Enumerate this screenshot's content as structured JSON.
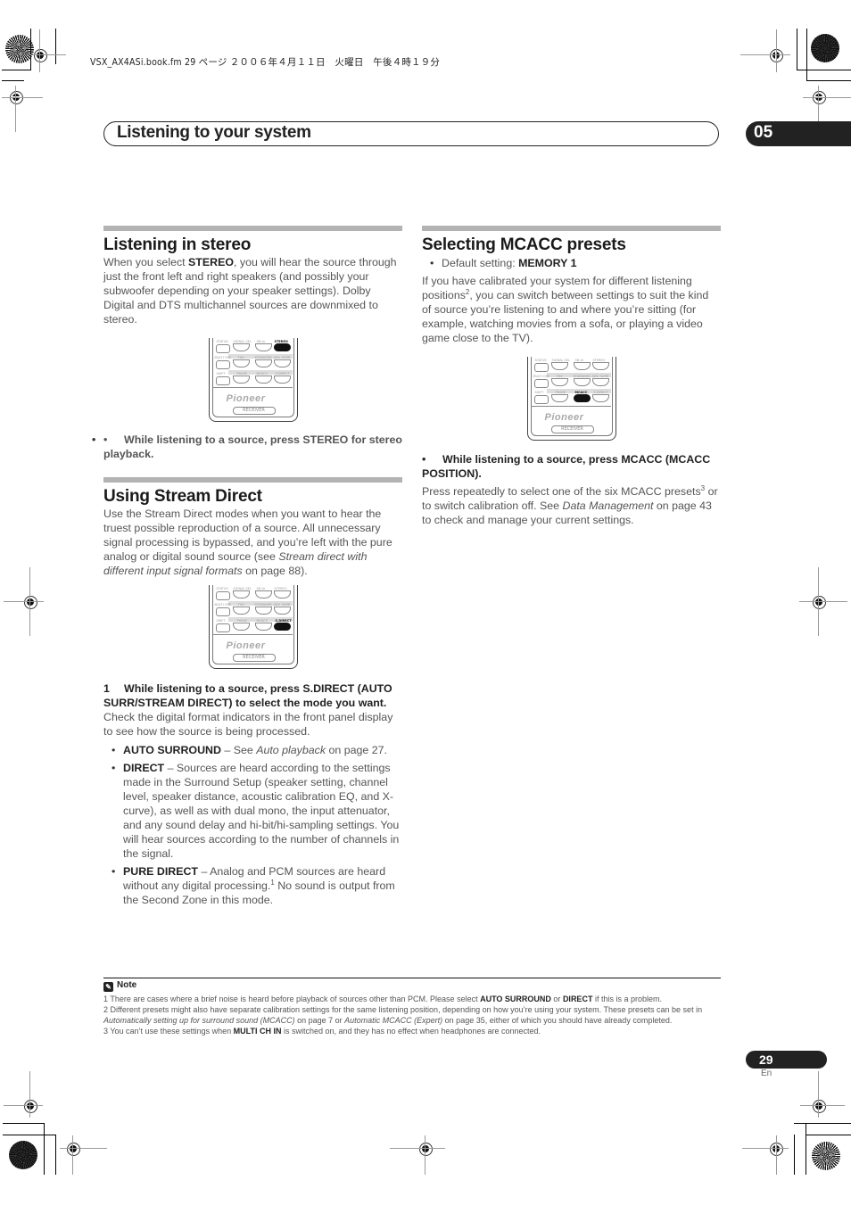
{
  "file_header": "VSX_AX4ASi.book.fm  29 ページ  ２００６年４月１１日　火曜日　午後４時１９分",
  "chapter": {
    "title": "Listening to your system",
    "number": "05"
  },
  "sections": {
    "stereo": {
      "heading": "Listening in stereo",
      "body_pre": "When you select ",
      "body_bold": "STEREO",
      "body_post": ", you will hear the source through just the front left and right speakers (and possibly your subwoofer depending on your speaker settings). Dolby Digital and DTS multichannel sources are downmixed to stereo.",
      "instruction": "While listening to a source, press STEREO for stereo playback.",
      "highlighted_key": "STEREO"
    },
    "stream_direct": {
      "heading": "Using Stream Direct",
      "body_pre": "Use the Stream Direct modes when you want to hear the truest possible reproduction of a source. All unnecessary signal processing is bypassed, and you’re left with the pure analog or digital sound source (see ",
      "body_italic": "Stream direct with different input signal formats",
      "body_post": " on page 88).",
      "step_number": "1",
      "step_text": "While listening to a source, press S.DIRECT (AUTO SURR/STREAM DIRECT) to select the mode you want.",
      "step_detail": "Check the digital format indicators in the front panel display to see how the source is being processed.",
      "highlighted_key": "S.DIRECT",
      "modes": [
        {
          "name": "AUTO SURROUND",
          "sep": " – See ",
          "italic": "Auto playback",
          "text": " on page 27."
        },
        {
          "name": "DIRECT",
          "sep": " – ",
          "italic": "",
          "text": "Sources are heard according to the settings made in the Surround Setup (speaker setting, channel level, speaker distance, acoustic calibration EQ, and X-curve), as well as with dual mono, the input attenuator, and any sound delay and hi-bit/hi-sampling settings. You will hear sources according to the number of channels in the signal."
        },
        {
          "name": "PURE DIRECT",
          "sep": " – ",
          "italic": "",
          "text": "Analog and PCM sources are heard without any digital processing.",
          "sup": "1",
          "text2": " No sound is output from the Second Zone in this mode."
        }
      ]
    },
    "mcacc": {
      "heading": "Selecting MCACC presets",
      "default_label": "Default setting: ",
      "default_value": "MEMORY 1",
      "body_pre": "If you have calibrated your system for different listening positions",
      "body_sup": "2",
      "body_post": ", you can switch between settings to suit the kind of source you’re listening to and where you’re sitting (for example, watching movies from a sofa, or playing a video game close to the TV).",
      "instruction": "While listening to a source, press MCACC (MCACC POSITION).",
      "detail_pre": "Press repeatedly to select one of the six MCACC presets",
      "detail_sup": "3",
      "detail_mid": " or to switch calibration off. See ",
      "detail_italic": "Data Management",
      "detail_post": " on page 43 to check and manage your current settings.",
      "highlighted_key": "MCACC"
    }
  },
  "remote": {
    "keys_row1": [
      "STATUS",
      "SIGNAL SEL",
      "SB ch",
      "STEREO"
    ],
    "keys_row2": [
      "MULTI OPE",
      "THX",
      "STANDARD",
      "ADV. SURR"
    ],
    "keys_row3": [
      "SHIFT",
      "PHASE",
      "MCACC",
      "S.DIRECT"
    ],
    "brand": "Pioneer",
    "mode_label": "RECEIVER"
  },
  "notes": {
    "heading": "Note",
    "items": [
      {
        "n": "1",
        "pre": "There are cases where a brief noise is heard before playback of sources other than PCM. Please select ",
        "b1": "AUTO SURROUND",
        "mid": " or ",
        "b2": "DIRECT",
        "post": " if this is a problem."
      },
      {
        "n": "2",
        "pre": "Different presets might also have separate calibration settings for the same listening position, depending on how you’re using your system. These presets can be set in ",
        "i1": "Automatically setting up for surround sound (MCACC)",
        "mid": " on page 7 or ",
        "i2": "Automatic MCACC (Expert)",
        "post": " on page 35, either of which you should have already completed."
      },
      {
        "n": "3",
        "pre": "You can’t use these settings when ",
        "b1": "MULTI CH IN",
        "post": " is switched on, and they has no effect when headphones are connected."
      }
    ]
  },
  "footer": {
    "page_number": "29",
    "language": "En"
  }
}
